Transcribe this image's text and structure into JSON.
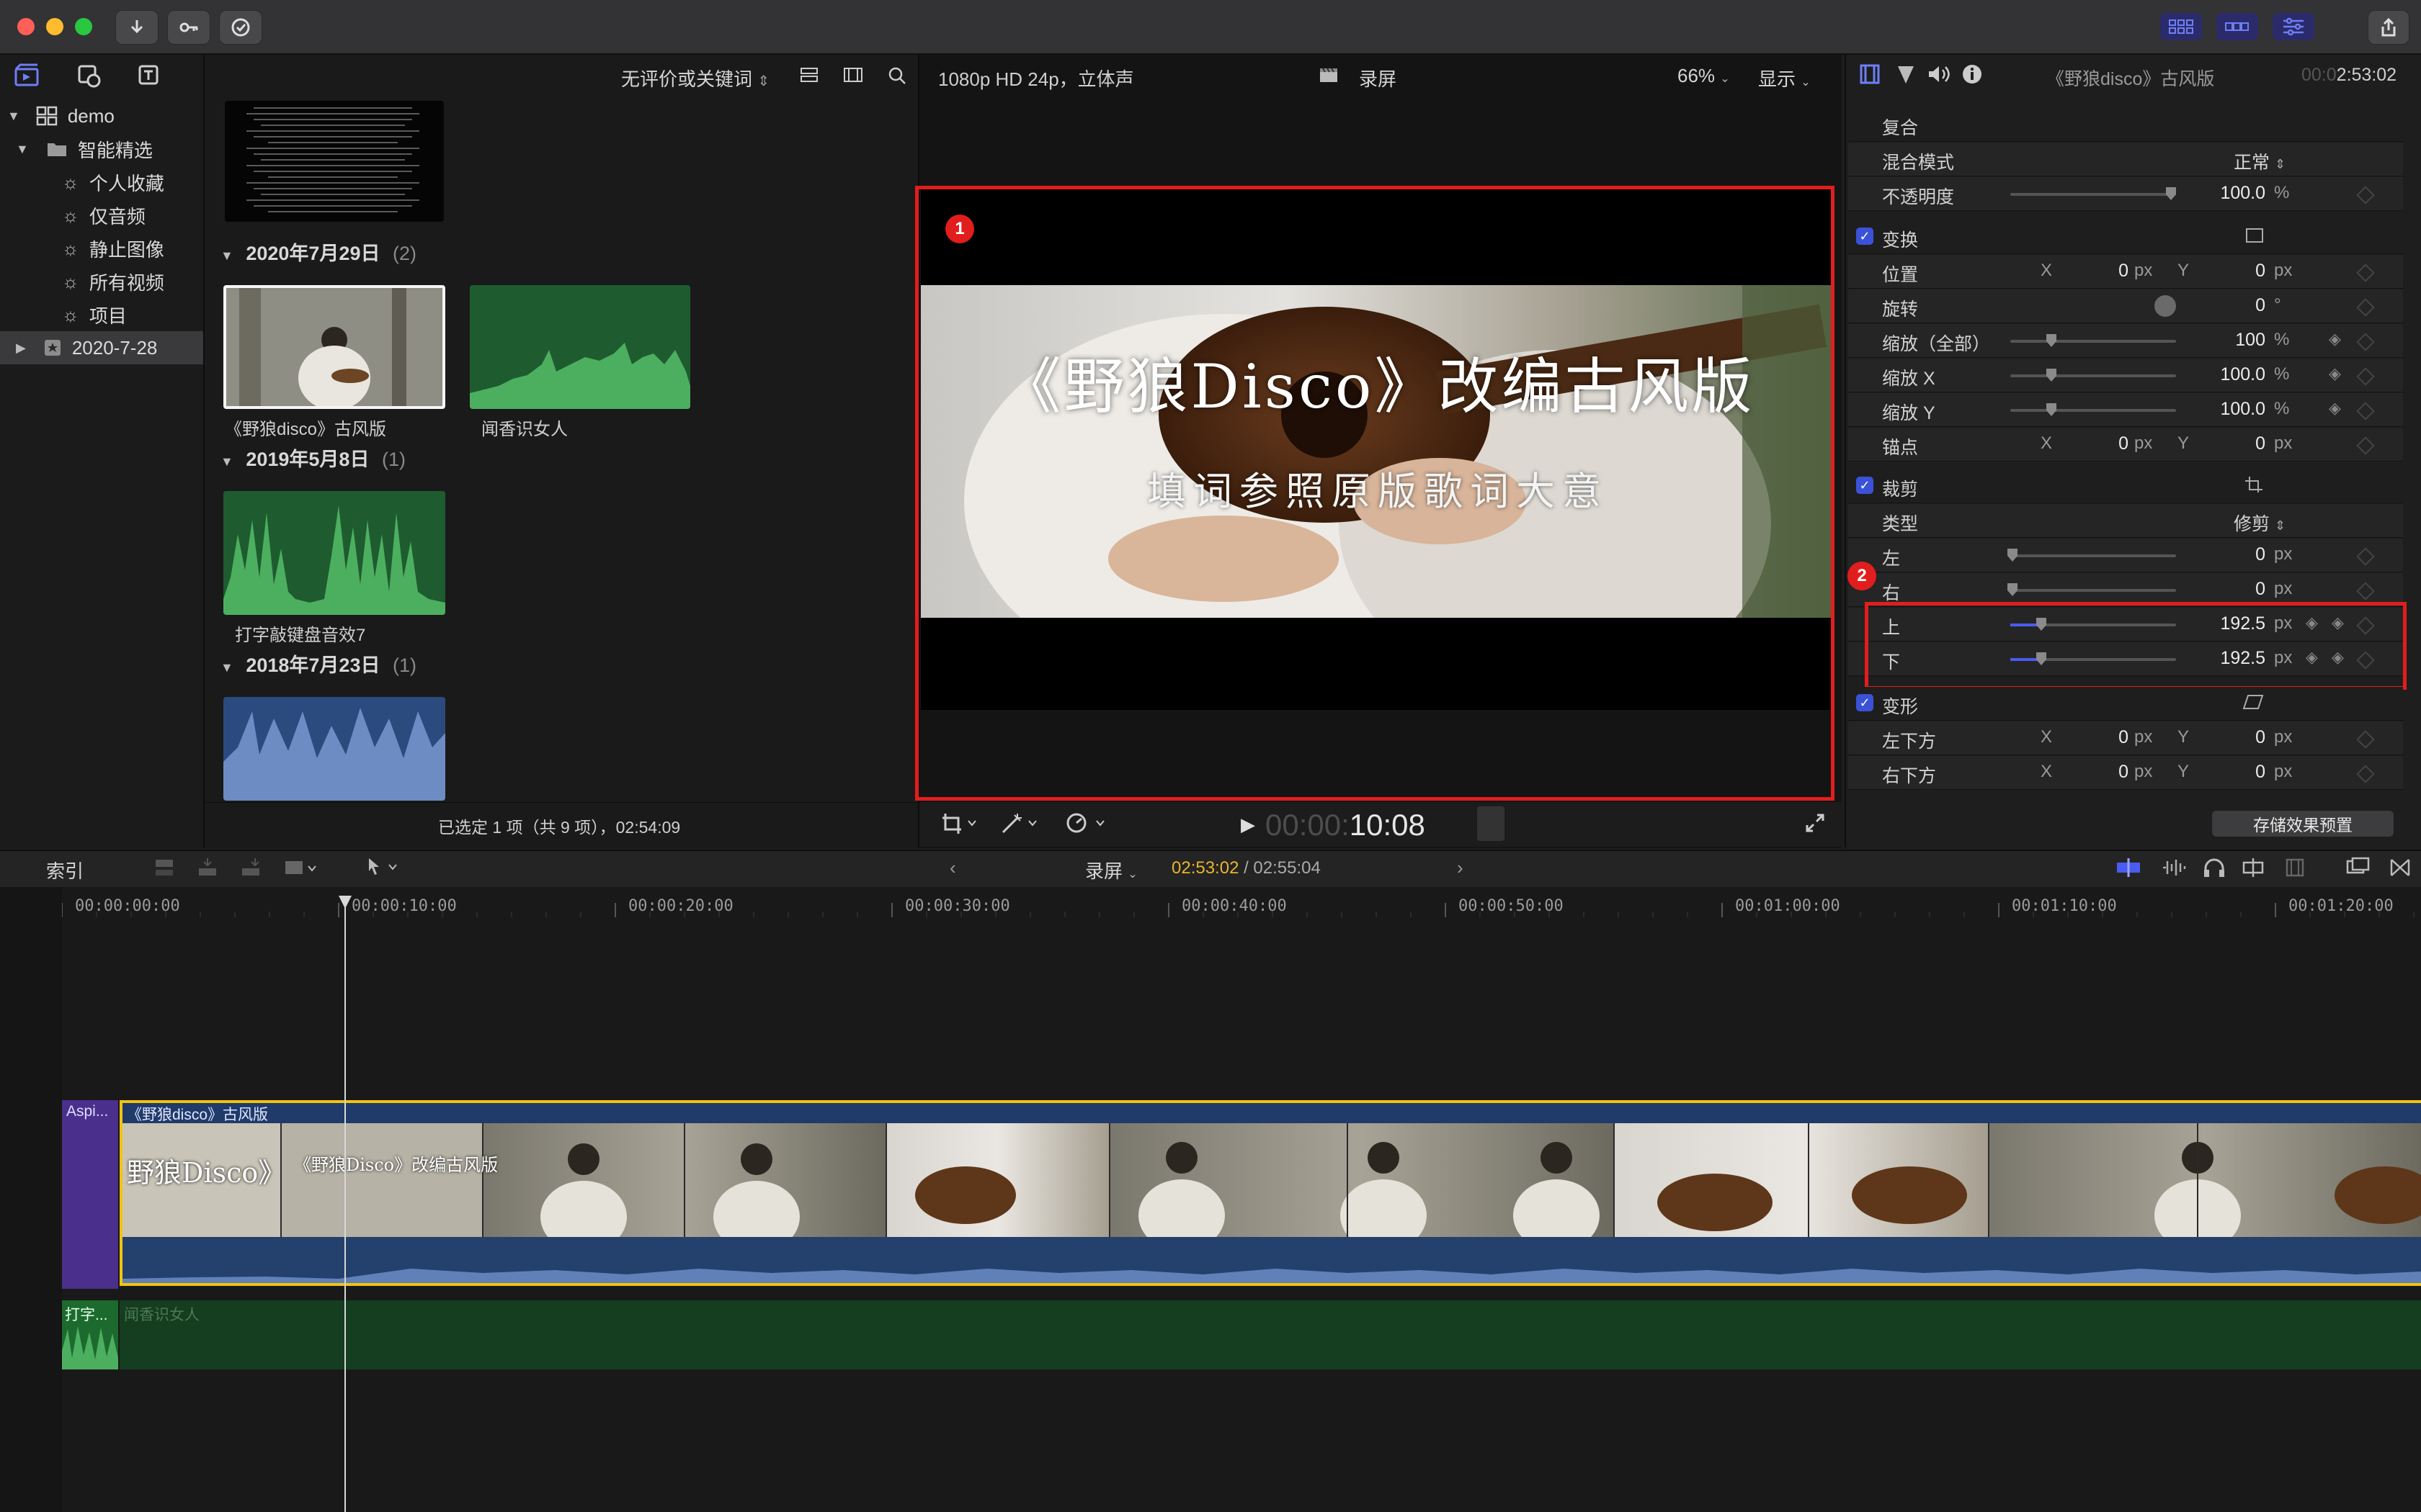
{
  "toolbar": {
    "import_icon": "download-arrow-icon",
    "keyword_icon": "key-icon",
    "tasks_icon": "checkmark-circle-icon",
    "share_icon": "share-icon"
  },
  "library": {
    "items": [
      {
        "label": "demo",
        "icon": "library-grid-icon"
      },
      {
        "label": "智能精选",
        "icon": "folder-icon"
      },
      {
        "label": "个人收藏",
        "icon": "gear-icon"
      },
      {
        "label": "仅音频",
        "icon": "gear-icon"
      },
      {
        "label": "静止图像",
        "icon": "gear-icon"
      },
      {
        "label": "所有视频",
        "icon": "gear-icon"
      },
      {
        "label": "项目",
        "icon": "gear-icon"
      },
      {
        "label": "2020-7-28",
        "icon": "star-event-icon"
      }
    ]
  },
  "browser": {
    "filter_label": "无评价或关键词",
    "groups": [
      {
        "date": "2020年7月29日",
        "count": "(2)"
      },
      {
        "date": "2019年5月8日",
        "count": "(1)"
      },
      {
        "date": "2018年7月23日",
        "count": "(1)"
      }
    ],
    "clips": [
      "《野狼disco》古风版",
      "闻香识女人",
      "打字敲键盘音效7"
    ],
    "status": "已选定 1 项（共 9 项），02:54:09"
  },
  "viewer": {
    "format": "1080p HD 24p，立体声",
    "title": "录屏",
    "zoom": "66%",
    "display": "显示",
    "video_title": "《野狼Disco》改编古风版",
    "video_subtitle": "填词参照原版歌词大意",
    "timecode_dim": "00:00:",
    "timecode": "10:08",
    "badge1": "1"
  },
  "inspector": {
    "clip_name": "《野狼disco》古风版",
    "duration_dim": "00:0",
    "duration": "2:53:02",
    "compositing": "复合",
    "blend_mode_label": "混合模式",
    "blend_mode_value": "正常",
    "opacity_label": "不透明度",
    "opacity_value": "100.0",
    "opacity_unit": "%",
    "transform": "变换",
    "position": "位置",
    "rotation": "旋转",
    "scale_all": "缩放（全部）",
    "scale_x": "缩放 X",
    "scale_y": "缩放 Y",
    "anchor": "锚点",
    "crop": "裁剪",
    "type_label": "类型",
    "type_value": "修剪",
    "left": "左",
    "right": "右",
    "top": "上",
    "bottom": "下",
    "distort": "变形",
    "bottom_left": "左下方",
    "bottom_right": "右下方",
    "x": "X",
    "y": "Y",
    "px": "px",
    "pct": "%",
    "deg": "°",
    "zero": "0",
    "v100": "100",
    "v1000": "100.0",
    "v1925": "192.5",
    "save_preset": "存储效果预置",
    "badge2": "2"
  },
  "timeline": {
    "index": "索引",
    "project": "录屏",
    "current_time": "02:53:02",
    "total_time": "/ 02:55:04",
    "ruler_labels": [
      "00:00:00:00",
      "00:00:10:00",
      "00:00:20:00",
      "00:00:30:00",
      "00:00:40:00",
      "00:00:50:00",
      "00:01:00:00",
      "00:01:10:00",
      "00:01:20:00"
    ],
    "connected_clip": "Aspi...",
    "main_clip": "《野狼disco》古风版",
    "main_clip_title1": "野狼Disco》",
    "main_clip_title2": "《野狼Disco》改编古风版",
    "audio_clip_short": "打字...",
    "audio_clip": "闻香识女人"
  },
  "colors": {
    "accent_blue": "#3b52d8",
    "highlight_red": "#e21d1d",
    "timecode_yellow": "#e8b42c",
    "clip_border": "#f1c40f"
  }
}
